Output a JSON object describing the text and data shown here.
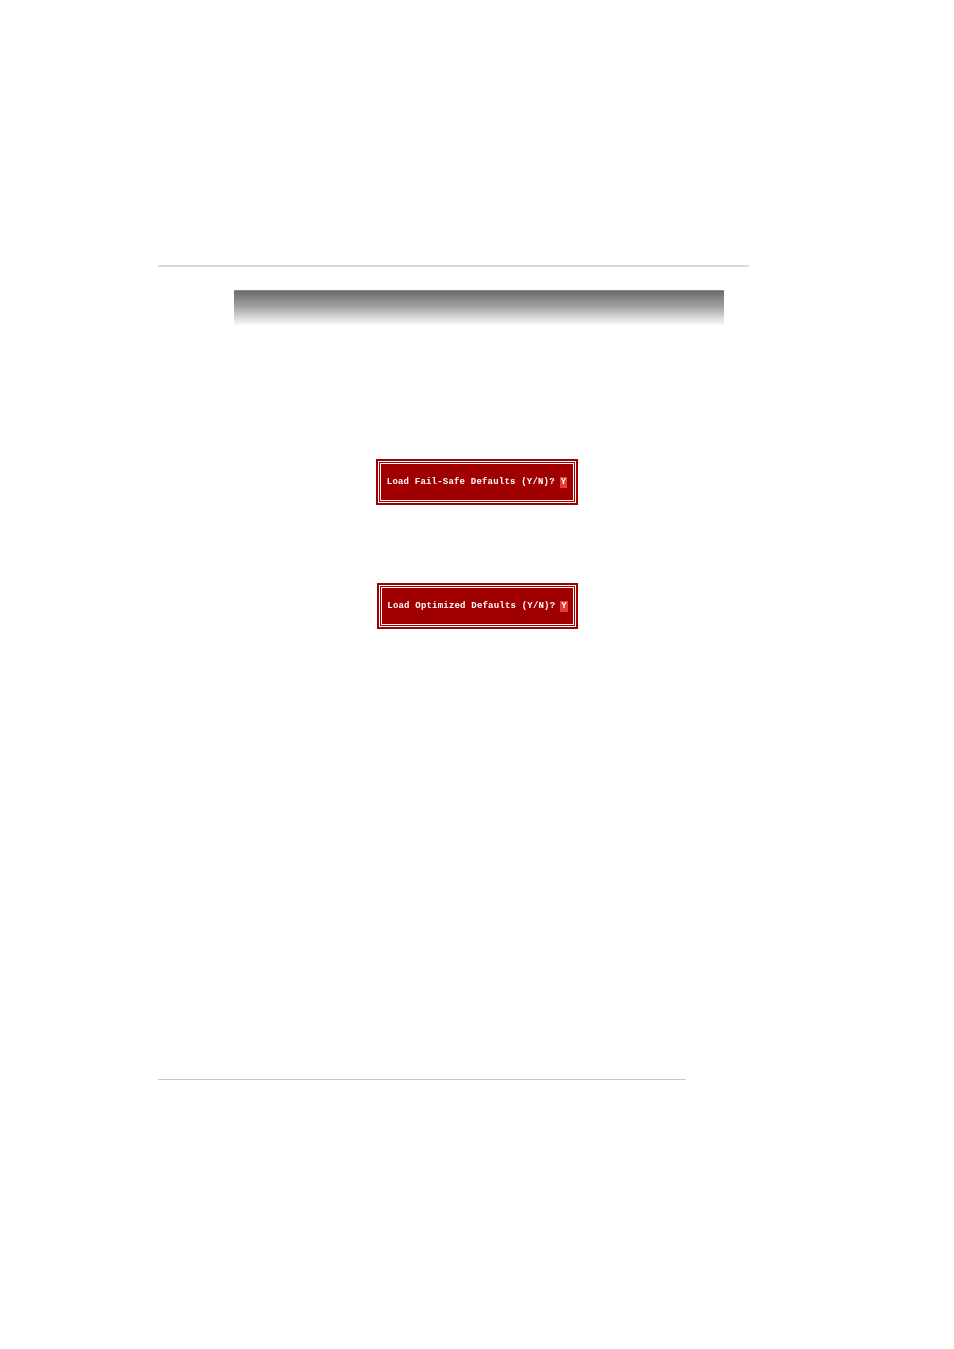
{
  "dialogs": [
    {
      "prompt": "Load Fail-Safe Defaults (Y/N)?",
      "answer": "Y"
    },
    {
      "prompt": "Load Optimized Defaults (Y/N)?",
      "answer": "Y"
    }
  ]
}
